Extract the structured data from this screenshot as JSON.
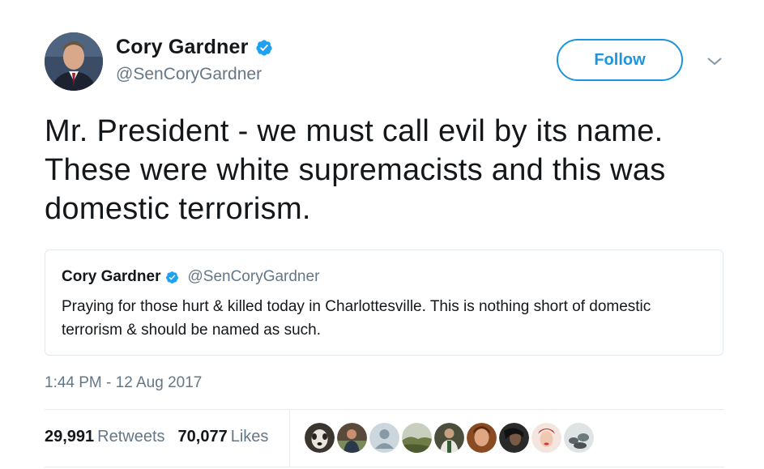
{
  "author": {
    "name": "Cory Gardner",
    "handle": "@SenCoryGardner",
    "avatar_icon": "avatar"
  },
  "actions": {
    "follow_label": "Follow"
  },
  "tweet": {
    "text": "Mr. President - we must call evil by its name. These were white supremacists and this was domestic terrorism.",
    "timestamp": "1:44 PM - 12 Aug 2017"
  },
  "quoted_tweet": {
    "name": "Cory Gardner",
    "handle": "@SenCoryGardner",
    "text": "Praying for those hurt & killed today in Charlottesville. This is nothing short of domestic terrorism & should be named as such."
  },
  "stats": {
    "retweets_count": "29,991",
    "retweets_label": "Retweets",
    "likes_count": "70,077",
    "likes_label": "Likes"
  },
  "likers": [
    {
      "icon": "dog-avatar",
      "bg": "#3b3530"
    },
    {
      "icon": "person-avatar",
      "bg": "#5a4a3c"
    },
    {
      "icon": "default-avatar",
      "bg": "#ccd6dd"
    },
    {
      "icon": "landscape-avatar",
      "bg": "#7d8c5a"
    },
    {
      "icon": "person-avatar",
      "bg": "#4a4e3a"
    },
    {
      "icon": "person-avatar",
      "bg": "#8a4a22"
    },
    {
      "icon": "person-avatar",
      "bg": "#2a2a2a"
    },
    {
      "icon": "person-avatar",
      "bg": "#e8c8b8"
    },
    {
      "icon": "landscape-avatar",
      "bg": "#6d7a7e"
    }
  ],
  "colors": {
    "accent": "#1b95e0",
    "verified": "#1da1f2",
    "secondary_text": "#657786"
  }
}
